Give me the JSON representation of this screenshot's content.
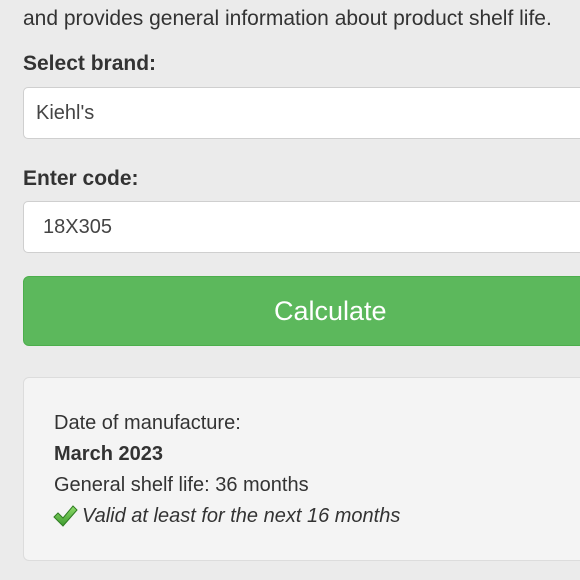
{
  "intro": {
    "text": "and provides general information about product shelf life."
  },
  "form": {
    "brand_label": "Select brand:",
    "brand_value": "Kiehl's",
    "code_label": "Enter code:",
    "code_value": "18X305",
    "calculate_label": "Calculate"
  },
  "result": {
    "manufacture_label": "Date of manufacture:",
    "manufacture_date": "March 2023",
    "shelf_life": "General shelf life: 36 months",
    "validity": "Valid at least for the next 16 months",
    "validity_icon": "checkmark-icon",
    "validity_color": "#5cb85c"
  },
  "colors": {
    "background": "#ebebeb",
    "button": "#5cb85c",
    "button_text": "#ffffff",
    "panel": "#f4f4f4"
  }
}
